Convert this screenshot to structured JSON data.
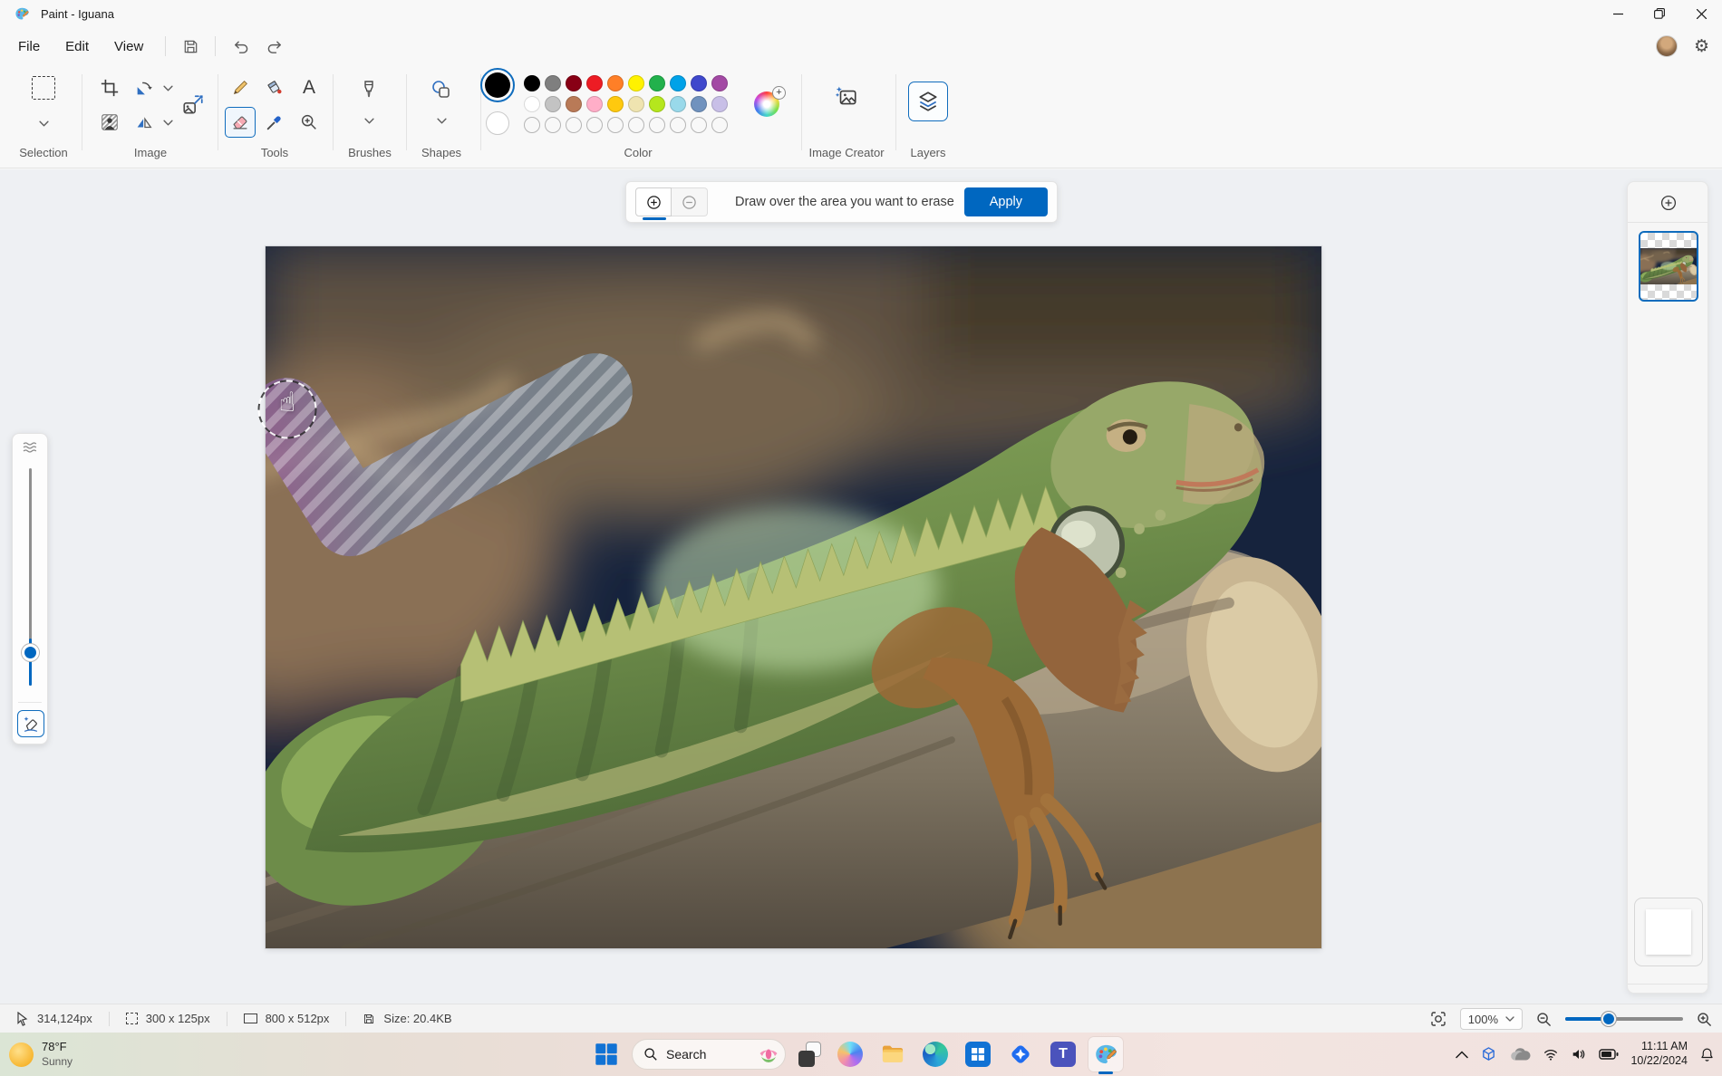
{
  "window": {
    "title": "Paint - Iguana"
  },
  "menu": {
    "items": [
      "File",
      "Edit",
      "View"
    ]
  },
  "ribbon": {
    "labels": {
      "selection": "Selection",
      "image": "Image",
      "tools": "Tools",
      "brushes": "Brushes",
      "shapes": "Shapes",
      "color": "Color",
      "image_creator": "Image Creator",
      "layers": "Layers"
    },
    "text_tool_glyph": "A"
  },
  "colors": {
    "accent": "#0067c0",
    "color1": "#000000",
    "color2": "#ffffff",
    "palette": [
      [
        "#000000",
        "#7f7f7f",
        "#880015",
        "#ed1c24",
        "#ff7f27",
        "#fff200",
        "#22b14c",
        "#00a2e8",
        "#3f48cc",
        "#a349a4"
      ],
      [
        "#ffffff",
        "#c3c3c3",
        "#b97a57",
        "#ffaec8",
        "#ffc90e",
        "#efe4b0",
        "#b5e61d",
        "#99d9ea",
        "#7092be",
        "#c8bfe7"
      ]
    ],
    "empty_slots": 10
  },
  "erase_banner": {
    "message": "Draw over the area you want to erase",
    "apply_label": "Apply"
  },
  "status_bar": {
    "cursor_position": "314,124px",
    "selection_size": "300 x 125px",
    "image_size": "800 x 512px",
    "file_size": "Size: 20.4KB",
    "zoom_level": "100%"
  },
  "taskbar": {
    "weather_temp": "78°F",
    "weather_condition": "Sunny",
    "search_placeholder": "Search",
    "time": "11:11 AM",
    "date": "10/22/2024"
  }
}
